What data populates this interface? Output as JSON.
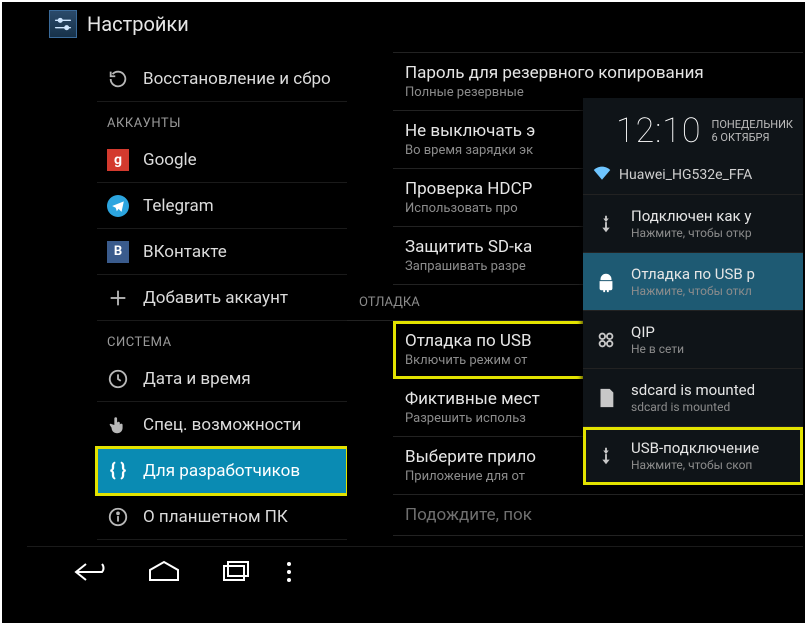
{
  "header": {
    "title": "Настройки"
  },
  "sidebar": {
    "top_item": "Восстановление и сбро",
    "sections": {
      "accounts": "АККАУНТЫ",
      "system": "СИСТЕМА"
    },
    "accounts": [
      {
        "label": "Google",
        "icon": "google"
      },
      {
        "label": "Telegram",
        "icon": "telegram"
      },
      {
        "label": "ВКонтакте",
        "icon": "vk"
      },
      {
        "label": "Добавить аккаунт",
        "icon": "plus"
      }
    ],
    "system": [
      {
        "label": "Дата и время",
        "icon": "clock"
      },
      {
        "label": "Спец. возможности",
        "icon": "hand"
      },
      {
        "label": "Для разработчиков",
        "icon": "braces",
        "selected": true,
        "highlight": true
      },
      {
        "label": "О планшетном ПК",
        "icon": "info"
      }
    ]
  },
  "detail": {
    "items_top": [
      {
        "title": "Пароль для резервного копирования",
        "sub": "Полные резервные"
      },
      {
        "title": "Не выключать э",
        "sub": "Во время зарядки эк"
      },
      {
        "title": "Проверка HDCP",
        "sub": "Использовать про"
      },
      {
        "title": "Защитить SD-ка",
        "sub": "Запрашивать разре"
      }
    ],
    "section": "ОТЛАДКА",
    "items_bottom": [
      {
        "title": "Отладка по USB",
        "sub": "Включить режим от",
        "highlight": true
      },
      {
        "title": "Фиктивные мест",
        "sub": "Разрешить использ"
      },
      {
        "title": "Выберите прило",
        "sub": "Приложение для от"
      }
    ],
    "footer": "Подождите, пок"
  },
  "qs": {
    "time": "12:10",
    "day": "ПОНЕДЕЛЬНИК",
    "date": "6 ОКТЯБРЯ",
    "wifi": "Huawei_HG532e_FFA",
    "notifications": [
      {
        "icon": "usb",
        "title": "Подключен как у",
        "sub": "Нажмите, чтобы откр"
      },
      {
        "icon": "android",
        "title": "Отладка по USB р",
        "sub": "Нажмите, чтобы откл",
        "active": true
      },
      {
        "icon": "qip",
        "title": "QIP",
        "sub": "Не в сети"
      },
      {
        "icon": "sdcard",
        "title": "sdcard is mounted",
        "sub": "sdcard is mounted"
      },
      {
        "icon": "usb",
        "title": "USB-подключение",
        "sub": "Нажмите, чтобы скоп",
        "highlight": true
      }
    ]
  }
}
